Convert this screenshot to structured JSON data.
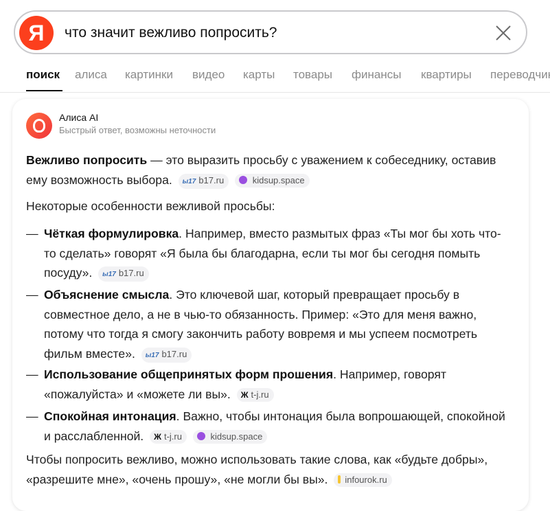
{
  "search": {
    "logo_letter": "Я",
    "query": "что значит вежливо попросить?"
  },
  "tabs": [
    {
      "label": "поиск",
      "active": true
    },
    {
      "label": "алиса"
    },
    {
      "label": "картинки"
    },
    {
      "label": "видео"
    },
    {
      "label": "карты"
    },
    {
      "label": "товары"
    },
    {
      "label": "финансы"
    },
    {
      "label": "квартиры"
    },
    {
      "label": "переводчик"
    }
  ],
  "answer": {
    "title": "Алиса AI",
    "subtitle": "Быстрый ответ, возможны неточности",
    "intro_bold": "Вежливо попросить",
    "intro_text": " — это выразить просьбу с уважением к собеседнику, оставив ему возможность выбора.",
    "features_heading": "Некоторые особенности вежливой просьбы:",
    "bullets": [
      {
        "bold": "Чёткая формулировка",
        "text": ". Например, вместо размытых фраз «Ты мог бы хоть что-то сделать» говорят «Я была бы благодарна, если ты мог бы сегодня помыть посуду».",
        "sources": [
          "b17.ru"
        ]
      },
      {
        "bold": "Объяснение смысла",
        "text": ". Это ключевой шаг, который превращает просьбу в совместное дело, а не в чью-то обязанность. Пример: «Это для меня важно, потому что тогда я смогу закончить работу вовремя и мы успеем посмотреть фильм вместе».",
        "sources": [
          "b17.ru"
        ]
      },
      {
        "bold": "Использование общепринятых форм прошения",
        "text": ". Например, говорят «пожалуйста» и «можете ли вы».",
        "sources": [
          "t-j.ru"
        ]
      },
      {
        "bold": "Спокойная интонация",
        "text": ". Важно, чтобы интонация была вопрошающей, спокойной и расслабленной.",
        "sources": [
          "t-j.ru",
          "kidsup.space"
        ]
      }
    ],
    "conclusion": "Чтобы попросить вежливо, можно использовать такие слова, как «будьте добры», «разрешите мне», «очень прошу», «не могли бы вы».",
    "sources": {
      "b17": "b17.ru",
      "b17_icon": "ы17",
      "kidsup": "kidsup.space",
      "tj": "t-j.ru",
      "tj_icon": "Ж",
      "infourok": "infourok.ru"
    }
  },
  "colors": {
    "yandex_red": "#fc3f1d",
    "tab_inactive": "#8b8b8b",
    "source_chip_bg": "#f2f2f4"
  }
}
